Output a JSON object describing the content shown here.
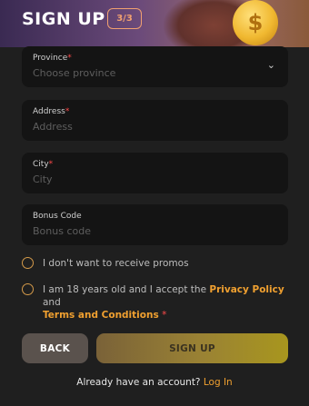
{
  "header": {
    "title": "SIGN UP",
    "step": "3/3"
  },
  "fields": {
    "province": {
      "label": "Province",
      "required": "*",
      "placeholder": "Choose province"
    },
    "address": {
      "label": "Address",
      "required": "*",
      "placeholder": "Address"
    },
    "city": {
      "label": "City",
      "required": "*",
      "placeholder": "City"
    },
    "bonus": {
      "label": "Bonus Code",
      "placeholder": "Bonus code"
    }
  },
  "checks": {
    "promos": "I don't want to receive promos",
    "terms_prefix": "I am 18 years old and I accept the",
    "privacy": "Privacy Policy",
    "and": "and",
    "terms": "Terms and Conditions",
    "terms_req": "*"
  },
  "buttons": {
    "back": "BACK",
    "signup": "SIGN UP"
  },
  "footer": {
    "text": "Already have an account?",
    "login": "Log In"
  },
  "colors": {
    "accent": "#f0a030",
    "required": "#ff4a4a",
    "field_bg": "#141414"
  }
}
